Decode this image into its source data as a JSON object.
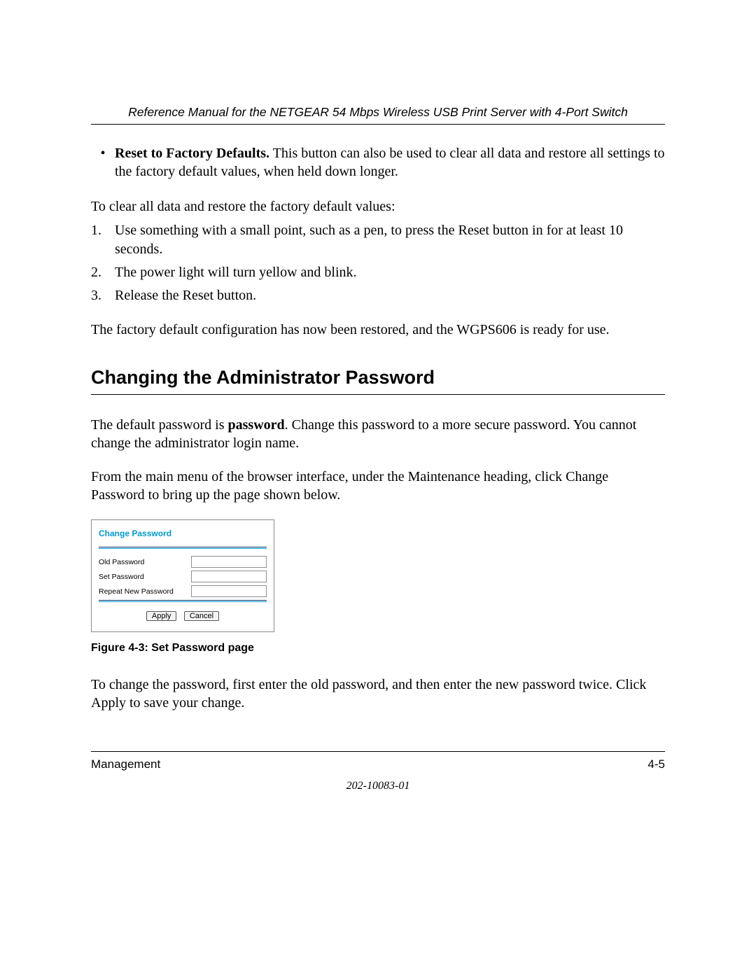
{
  "header": {
    "title": "Reference Manual for the NETGEAR 54 Mbps Wireless USB Print Server with 4-Port Switch"
  },
  "bullet": {
    "bold": "Reset to Factory Defaults.",
    "rest": " This button can also be used to clear all data and restore all settings to the factory default values, when held down longer."
  },
  "intro": "To clear all data and restore the factory default values:",
  "steps": [
    "Use something with a small point, such as a pen, to press the Reset button in for at least 10 seconds.",
    "The power light will turn yellow and blink.",
    "Release the Reset button."
  ],
  "closing": "The factory default configuration has now been restored, and the WGPS606 is ready for use.",
  "section_heading": "Changing the Administrator Password",
  "para1": {
    "pre": "The default password is ",
    "bold": "password",
    "post": ". Change this password to a more secure password. You cannot change the administrator login name."
  },
  "para2": "From the main menu of the browser interface, under the Maintenance heading, click Change Password to bring up the page shown below.",
  "cp": {
    "title": "Change Password",
    "row1": "Old Password",
    "row2": "Set Password",
    "row3": "Repeat New Password",
    "apply": "Apply",
    "cancel": "Cancel"
  },
  "fig_caption": "Figure 4-3:  Set Password page",
  "para3": "To change the password, first enter the old password, and then enter the new password twice. Click Apply to save your change.",
  "footer": {
    "left": "Management",
    "right": "4-5",
    "docnum": "202-10083-01"
  }
}
